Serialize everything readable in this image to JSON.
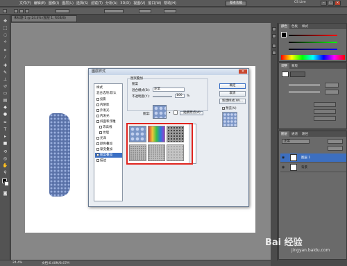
{
  "menu": [
    "文件(F)",
    "编辑(E)",
    "图像(I)",
    "图层(L)",
    "选择(S)",
    "滤镜(T)",
    "分析(A)",
    "3D(D)",
    "视图(V)",
    "窗口(W)",
    "帮助(H)"
  ],
  "topbar": {
    "workspace": "基本功能",
    "live": "CS Live"
  },
  "document": {
    "tab": "未标题-1 @ 24.4% (图层 1, RGB/8)"
  },
  "status": {
    "zoom": "24.4%",
    "info": "文档:6.40M/8.67M"
  },
  "dialog": {
    "title": "图层样式",
    "close": "×",
    "styles": [
      {
        "label": "样式",
        "checkbox": false,
        "selected": false
      },
      {
        "label": "混合选项:默认",
        "checkbox": false,
        "selected": false
      },
      {
        "label": "投影",
        "checkbox": true,
        "selected": false
      },
      {
        "label": "内阴影",
        "checkbox": true,
        "selected": false
      },
      {
        "label": "外发光",
        "checkbox": true,
        "selected": false
      },
      {
        "label": "内发光",
        "checkbox": true,
        "selected": false
      },
      {
        "label": "斜面和浮雕",
        "checkbox": true,
        "selected": false
      },
      {
        "label": "等高线",
        "checkbox": true,
        "selected": false
      },
      {
        "label": "纹理",
        "checkbox": true,
        "selected": false
      },
      {
        "label": "光泽",
        "checkbox": true,
        "selected": false
      },
      {
        "label": "颜色叠加",
        "checkbox": true,
        "selected": false
      },
      {
        "label": "渐变叠加",
        "checkbox": true,
        "selected": false
      },
      {
        "label": "图案叠加",
        "checkbox": true,
        "selected": true
      },
      {
        "label": "描边",
        "checkbox": true,
        "selected": false
      }
    ],
    "section_title": "图案叠加",
    "subsection_title": "图案",
    "blend_mode_label": "混合模式(B):",
    "blend_mode_value": "正常",
    "opacity_label": "不透明度(Y):",
    "opacity_value": "100",
    "opacity_unit": "%",
    "pattern_label": "图案:",
    "snap_button": "贴紧原点(A)",
    "buttons": {
      "ok": "确定",
      "cancel": "取消",
      "new_style": "新建样式(W)...",
      "preview": "预览(V)"
    }
  },
  "panels": {
    "color_tabs": [
      "颜色",
      "色板",
      "样式"
    ],
    "adjust_tabs": [
      "调整",
      "蒙版"
    ],
    "layer_tabs": [
      "图层",
      "通道",
      "路径"
    ],
    "layer_blend": "正常",
    "layers": [
      {
        "name": "图层 1",
        "selected": true
      },
      {
        "name": "背景",
        "selected": false
      }
    ]
  },
  "watermark": {
    "main": "Bai 经验",
    "sub": "jingyan.baidu.com"
  }
}
